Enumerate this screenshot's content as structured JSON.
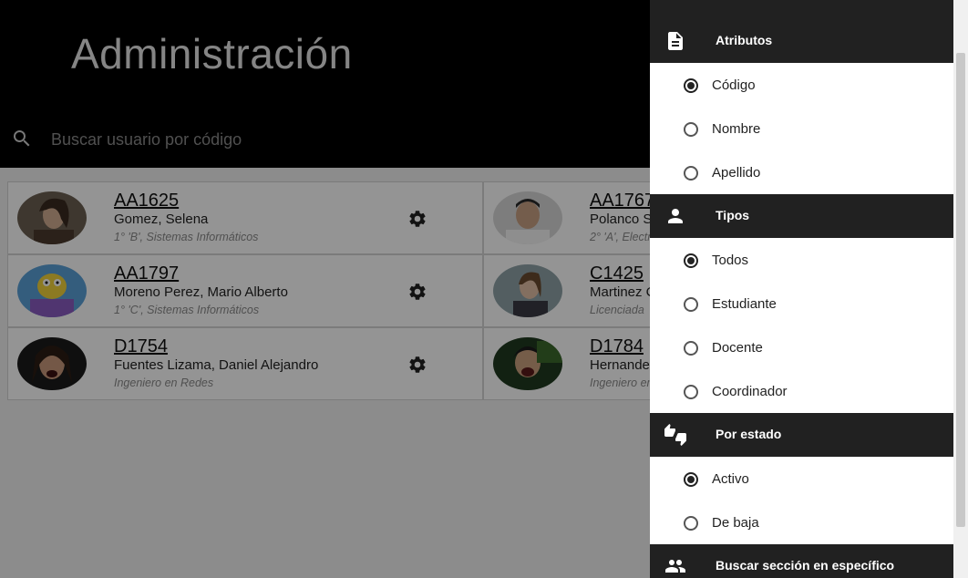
{
  "header": {
    "title": "Administración",
    "search_placeholder": "Buscar usuario por código"
  },
  "users": [
    {
      "code": "AA1625",
      "name": "Gomez, Selena",
      "detail": "1° 'B', Sistemas Informáticos"
    },
    {
      "code": "AA1767",
      "name": "Polanco S",
      "detail": "2° 'A', Electr"
    },
    {
      "code": "AA1797",
      "name": "Moreno Perez, Mario Alberto",
      "detail": "1° 'C', Sistemas Informáticos"
    },
    {
      "code": "C1425",
      "name": "Martinez C",
      "detail": "Licenciada"
    },
    {
      "code": "D1754",
      "name": "Fuentes Lizama, Daniel Alejandro",
      "detail": "Ingeniero en Redes"
    },
    {
      "code": "D1784",
      "name": "Hernandez",
      "detail": "Ingeniero en"
    }
  ],
  "panel": {
    "sections": [
      {
        "title": "Atributos",
        "icon": "document-icon",
        "options": [
          {
            "label": "Código",
            "checked": true
          },
          {
            "label": "Nombre",
            "checked": false
          },
          {
            "label": "Apellido",
            "checked": false
          }
        ]
      },
      {
        "title": "Tipos",
        "icon": "person-icon",
        "options": [
          {
            "label": "Todos",
            "checked": true
          },
          {
            "label": "Estudiante",
            "checked": false
          },
          {
            "label": "Docente",
            "checked": false
          },
          {
            "label": "Coordinador",
            "checked": false
          }
        ]
      },
      {
        "title": "Por estado",
        "icon": "thumbs-up-down-icon",
        "options": [
          {
            "label": "Activo",
            "checked": true
          },
          {
            "label": "De baja",
            "checked": false
          }
        ]
      },
      {
        "title": "Buscar sección en específico",
        "icon": "group-icon",
        "options": []
      }
    ]
  },
  "colors": {
    "header_bg": "#000000",
    "panel_header_bg": "#212121",
    "overlay": "rgba(0,0,0,0.42)"
  }
}
